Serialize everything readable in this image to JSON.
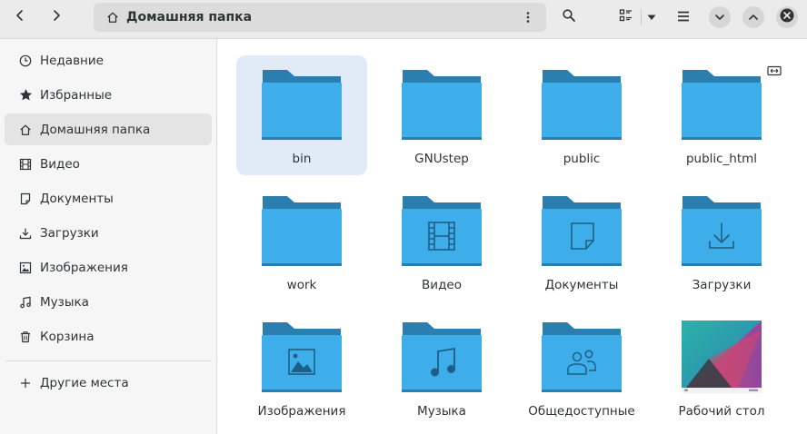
{
  "header": {
    "title": "Домашняя папка",
    "back_icon": "back-icon",
    "forward_icon": "forward-icon",
    "search_icon": "search-icon",
    "view_icon": "view-list-icon",
    "menu_icon": "hamburger-menu-icon",
    "minimize_icon": "chevron-down-icon",
    "maximize_icon": "chevron-up-icon",
    "close_icon": "close-icon"
  },
  "sidebar": {
    "items": [
      {
        "label": "Недавние",
        "icon": "clock-icon"
      },
      {
        "label": "Избранные",
        "icon": "star-icon"
      },
      {
        "label": "Домашняя папка",
        "icon": "home-icon",
        "active": true
      },
      {
        "label": "Видео",
        "icon": "film-icon"
      },
      {
        "label": "Документы",
        "icon": "document-icon"
      },
      {
        "label": "Загрузки",
        "icon": "download-icon"
      },
      {
        "label": "Изображения",
        "icon": "image-icon"
      },
      {
        "label": "Музыка",
        "icon": "music-icon"
      },
      {
        "label": "Корзина",
        "icon": "trash-icon"
      }
    ],
    "other": {
      "label": "Другие места",
      "icon": "plus-icon"
    }
  },
  "files": [
    {
      "name": "bin",
      "kind": "folder",
      "selected": true
    },
    {
      "name": "GNUstep",
      "kind": "folder"
    },
    {
      "name": "public",
      "kind": "folder"
    },
    {
      "name": "public_html",
      "kind": "folder"
    },
    {
      "name": "work",
      "kind": "folder"
    },
    {
      "name": "Видео",
      "kind": "folder-videos"
    },
    {
      "name": "Документы",
      "kind": "folder-documents"
    },
    {
      "name": "Загрузки",
      "kind": "folder-downloads"
    },
    {
      "name": "Изображения",
      "kind": "folder-pictures"
    },
    {
      "name": "Музыка",
      "kind": "folder-music"
    },
    {
      "name": "Общедоступные",
      "kind": "folder-public"
    },
    {
      "name": "Рабочий стол",
      "kind": "desktop-thumbnail"
    }
  ],
  "colors": {
    "folder_front": "#3daee9",
    "folder_back": "#2a7fb0",
    "selection": "#e1ebf7",
    "emblem": "#1d5f86"
  }
}
